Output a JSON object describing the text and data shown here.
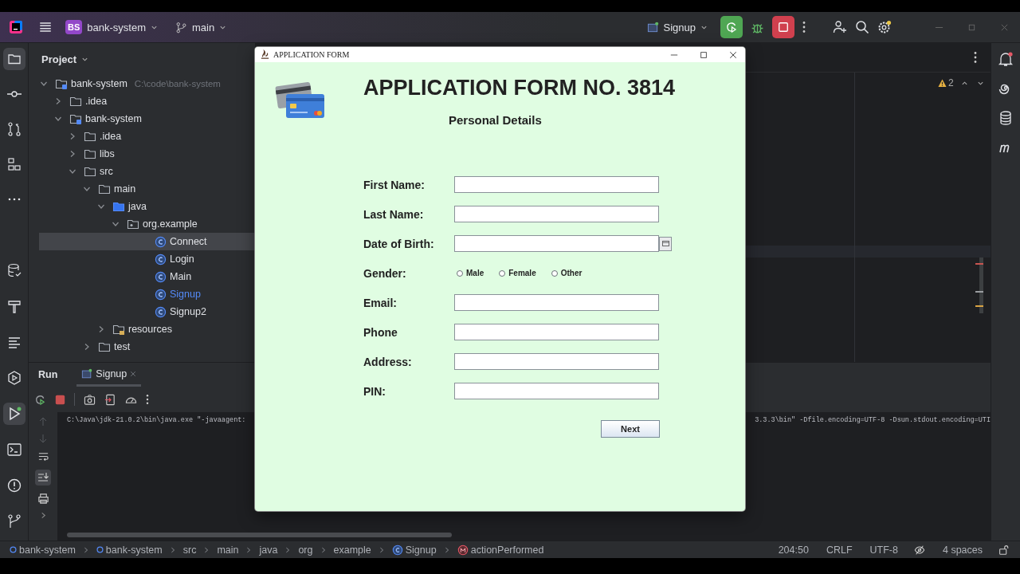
{
  "title_bar": {
    "project_badge": "BS",
    "project_name": "bank-system",
    "branch": "main",
    "run_config": "Signup"
  },
  "project_panel": {
    "title": "Project",
    "tree": [
      {
        "label": "bank-system",
        "path": "C:\\code\\bank-system",
        "kind": "module",
        "expanded": true,
        "selected": false,
        "modified": false,
        "children": [
          {
            "label": ".idea",
            "kind": "folder",
            "expanded": false,
            "selected": false,
            "modified": false
          },
          {
            "label": "bank-system",
            "kind": "module",
            "expanded": true,
            "selected": false,
            "modified": false,
            "children": [
              {
                "label": ".idea",
                "kind": "folder",
                "expanded": false,
                "selected": false,
                "modified": false
              },
              {
                "label": "libs",
                "kind": "folder",
                "expanded": false,
                "selected": false,
                "modified": false
              },
              {
                "label": "src",
                "kind": "folder",
                "expanded": true,
                "selected": false,
                "modified": false,
                "children": [
                  {
                    "label": "main",
                    "kind": "folder",
                    "expanded": true,
                    "selected": false,
                    "modified": false,
                    "children": [
                      {
                        "label": "java",
                        "kind": "source_folder",
                        "expanded": true,
                        "selected": false,
                        "modified": false,
                        "children": [
                          {
                            "label": "org.example",
                            "kind": "package",
                            "expanded": true,
                            "selected": false,
                            "modified": false,
                            "children": [
                              {
                                "label": "Connect",
                                "kind": "class",
                                "selected": true,
                                "modified": false
                              },
                              {
                                "label": "Login",
                                "kind": "class",
                                "selected": false,
                                "modified": false
                              },
                              {
                                "label": "Main",
                                "kind": "class",
                                "selected": false,
                                "modified": false
                              },
                              {
                                "label": "Signup",
                                "kind": "class",
                                "selected": false,
                                "modified": true
                              },
                              {
                                "label": "Signup2",
                                "kind": "class",
                                "selected": false,
                                "modified": false
                              }
                            ]
                          }
                        ]
                      },
                      {
                        "label": "resources",
                        "kind": "resources",
                        "expanded": false,
                        "selected": false,
                        "modified": false
                      }
                    ]
                  },
                  {
                    "label": "test",
                    "kind": "folder",
                    "expanded": false,
                    "selected": false,
                    "modified": false
                  }
                ]
              }
            ]
          }
        ]
      }
    ]
  },
  "editor": {
    "warning_count": "2"
  },
  "run_panel": {
    "title": "Run",
    "tabs": [
      {
        "label": "Signup",
        "selected": true
      }
    ],
    "console": {
      "visible_start": "C:\\Java\\jdk-21.0.2\\bin\\java.exe \"-javaagent:",
      "visible_end": "3.3.3\\bin\" -Dfile.encoding=UTF-8 -Dsun.stdout.encoding=UTI"
    }
  },
  "status_bar": {
    "breadcrumbs": [
      {
        "label": "bank-system",
        "kind": "module"
      },
      {
        "label": "bank-system",
        "kind": "module"
      },
      {
        "label": "src",
        "kind": "folder"
      },
      {
        "label": "main",
        "kind": "folder"
      },
      {
        "label": "java",
        "kind": "folder"
      },
      {
        "label": "org",
        "kind": "folder"
      },
      {
        "label": "example",
        "kind": "folder"
      },
      {
        "label": "Signup",
        "kind": "class"
      },
      {
        "label": "actionPerformed",
        "kind": "method"
      }
    ],
    "position": "204:50",
    "line_separator": "CRLF",
    "encoding": "UTF-8",
    "indent": "4 spaces"
  },
  "dialog": {
    "title": "APPLICATION FORM",
    "heading": "APPLICATION FORM NO. 3814",
    "subheading": "Personal Details",
    "fields": [
      {
        "label": "First Name:",
        "kind": "text"
      },
      {
        "label": "Last Name:",
        "kind": "text"
      },
      {
        "label": "Date of Birth:",
        "kind": "date"
      },
      {
        "label": "Gender:",
        "kind": "radio",
        "options": [
          {
            "label": "Male",
            "selected": false
          },
          {
            "label": "Female",
            "selected": false
          },
          {
            "label": "Other",
            "selected": false
          }
        ]
      },
      {
        "label": "Email:",
        "kind": "text"
      },
      {
        "label": "Phone",
        "kind": "text"
      },
      {
        "label": "Address:",
        "kind": "text"
      },
      {
        "label": "PIN:",
        "kind": "text"
      }
    ],
    "button": "Next"
  }
}
